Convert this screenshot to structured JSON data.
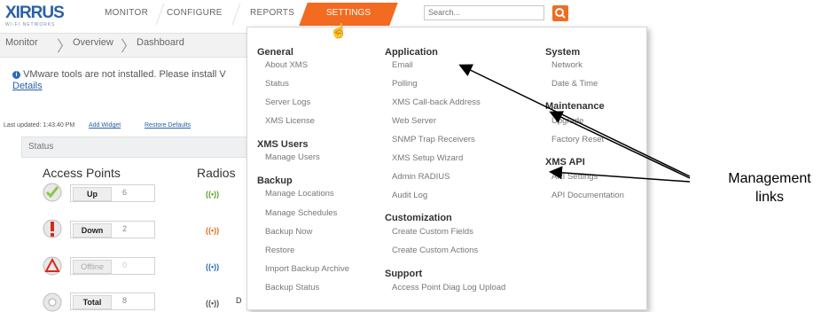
{
  "header": {
    "logo": "XIRRUS",
    "logo_sub": "WI-FI NETWORKS",
    "nav": [
      "MONITOR",
      "CONFIGURE",
      "REPORTS",
      "SETTINGS"
    ],
    "search_placeholder": "Search..."
  },
  "breadcrumb": [
    "Monitor",
    "Overview",
    "Dashboard"
  ],
  "notice": {
    "text": "VMware tools are not installed. Please install V",
    "link": "Details"
  },
  "toolbar": {
    "last_updated": "Last updated: 1:43:40 PM",
    "add_widget": "Add Widget",
    "restore_defaults": "Restore Defaults"
  },
  "status": {
    "title": "Status",
    "access_points_label": "Access Points",
    "radios_label": "Radios",
    "rows": [
      {
        "label": "Up",
        "value": "6"
      },
      {
        "label": "Down",
        "value": "2"
      },
      {
        "label": "Offline",
        "value": "0"
      },
      {
        "label": "Total",
        "value": "8"
      }
    ],
    "last_radio_partial": "D"
  },
  "menu": {
    "general": {
      "title": "General",
      "items": [
        "About XMS",
        "Status",
        "Server Logs",
        "XMS License"
      ]
    },
    "xms_users": {
      "title": "XMS Users",
      "items": [
        "Manage Users"
      ]
    },
    "backup": {
      "title": "Backup",
      "items": [
        "Manage Locations",
        "Manage Schedules",
        "Backup Now",
        "Restore",
        "Import Backup Archive",
        "Backup Status"
      ]
    },
    "application": {
      "title": "Application",
      "items": [
        "Email",
        "Polling",
        "XMS Call-back Address",
        "Web Server",
        "SNMP Trap Receivers",
        "XMS Setup Wizard",
        "Admin RADIUS",
        "Audit Log"
      ]
    },
    "customization": {
      "title": "Customization",
      "items": [
        "Create Custom Fields",
        "Create Custom Actions"
      ]
    },
    "support": {
      "title": "Support",
      "items": [
        "Access Point Diag Log Upload"
      ]
    },
    "system": {
      "title": "System",
      "items": [
        "Network",
        "Date & Time"
      ]
    },
    "maintenance": {
      "title": "Maintenance",
      "items": [
        "Upgrade",
        "Factory Reset"
      ]
    },
    "xms_api": {
      "title": "XMS API",
      "items": [
        "API Settings",
        "API Documentation"
      ]
    }
  },
  "annotation": {
    "line1": "Management",
    "line2": "links"
  },
  "colors": {
    "accent": "#f26b21",
    "brand": "#2a61a8"
  }
}
